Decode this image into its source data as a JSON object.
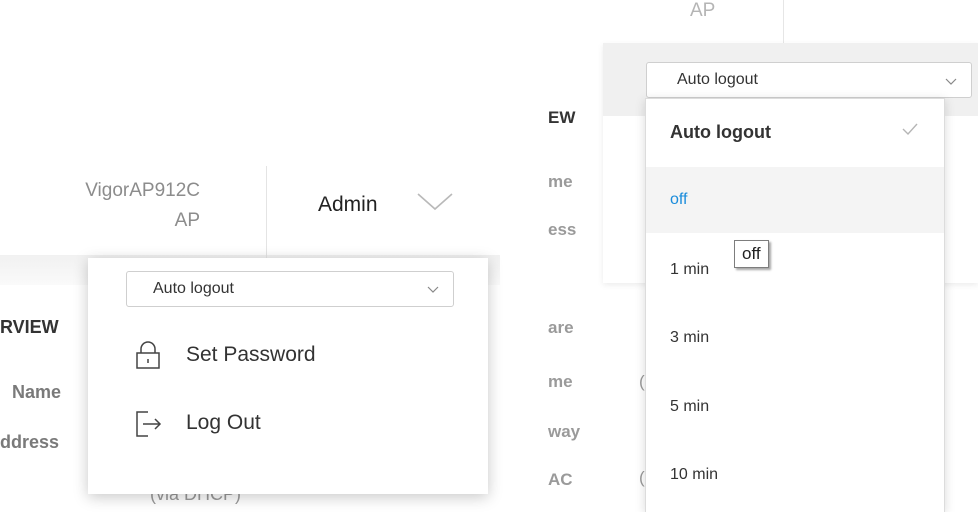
{
  "left": {
    "device_name_line1": "VigorAP912C",
    "device_name_line2": "AP",
    "admin_label": "Admin",
    "sidebar_overview": "RVIEW",
    "sidebar_name": "Name",
    "sidebar_address": "ddress",
    "sidebar_dhcp": "(via DHCP)",
    "dropdown": {
      "auto_logout_select": "Auto logout",
      "items": [
        {
          "label": "Set Password",
          "icon": "lock-icon"
        },
        {
          "label": "Log Out",
          "icon": "logout-icon"
        }
      ]
    }
  },
  "right": {
    "ap_label": "AP",
    "side_labels": [
      "EW",
      "me",
      "ess",
      "are",
      "me",
      "way",
      "AC"
    ],
    "select_value": "Auto logout",
    "options": [
      "Auto logout",
      "off",
      "1 min",
      "3 min",
      "5 min",
      "10 min"
    ],
    "selected_option": "Auto logout",
    "hovered_option": "off",
    "tooltip": "off"
  },
  "colors": {
    "accent_blue": "#1a8cdb",
    "text_dark": "#333333",
    "text_muted": "#8c8c8c"
  }
}
